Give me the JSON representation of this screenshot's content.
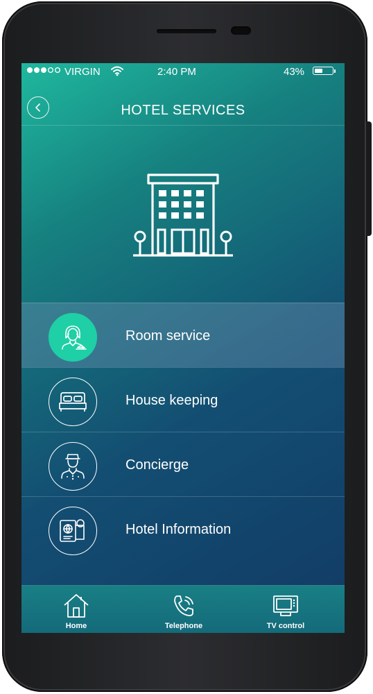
{
  "status_bar": {
    "carrier": "VIRGIN",
    "time": "2:40 PM",
    "battery": "43%",
    "battery_level": 0.43,
    "signal_bars_filled": 3,
    "signal_bars_total": 5
  },
  "header": {
    "title": "HOTEL SERVICES"
  },
  "menu": {
    "items": [
      {
        "label": "Room service",
        "icon": "room-service-icon",
        "active": true
      },
      {
        "label": "House keeping",
        "icon": "bed-icon",
        "active": false
      },
      {
        "label": "Concierge",
        "icon": "concierge-icon",
        "active": false
      },
      {
        "label": "Hotel Information",
        "icon": "hotel-information-icon",
        "active": false
      }
    ]
  },
  "tabbar": {
    "tabs": [
      {
        "label": "Home",
        "icon": "home-icon"
      },
      {
        "label": "Telephone",
        "icon": "telephone-icon"
      },
      {
        "label": "TV control",
        "icon": "tv-icon"
      }
    ]
  },
  "colors": {
    "accent": "#1fcfa6",
    "gradient_top": "#1fb89e",
    "gradient_bottom": "#123a64"
  }
}
